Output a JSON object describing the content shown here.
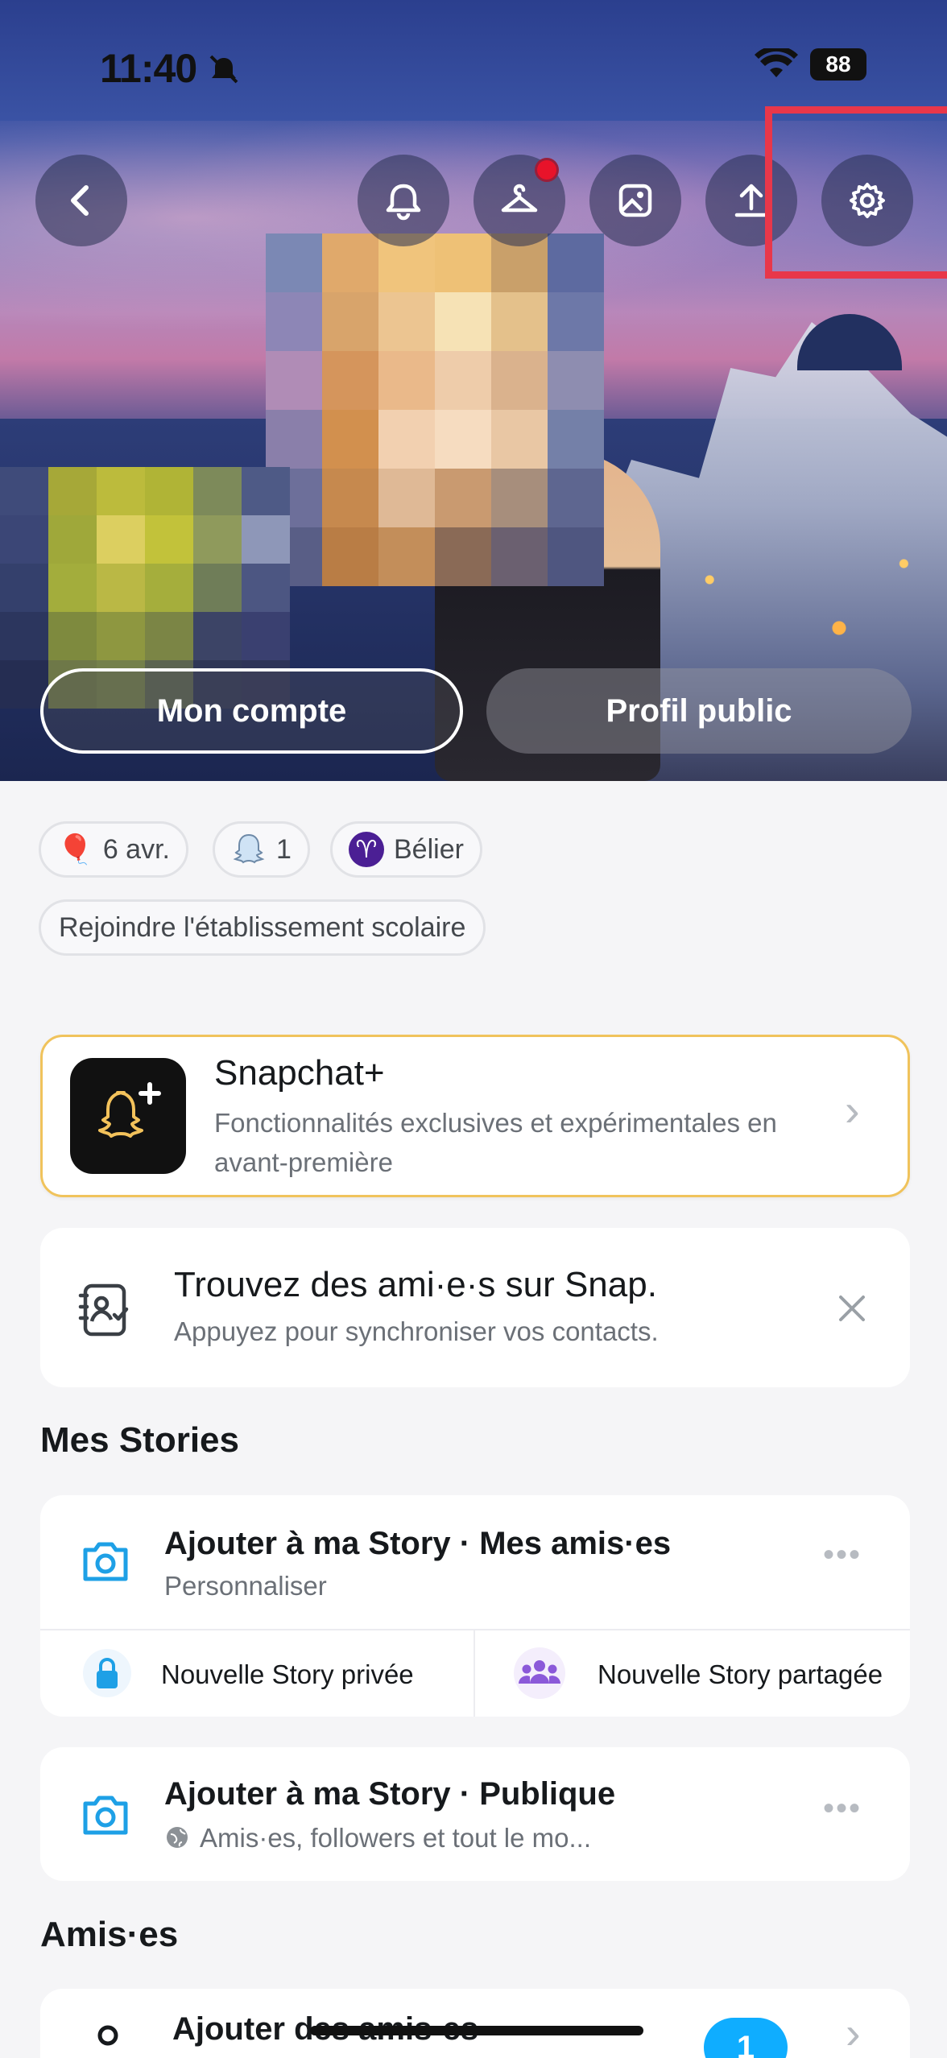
{
  "status_bar": {
    "time": "11:40",
    "battery": "88"
  },
  "profile_header": {
    "buttons": [
      "back",
      "notifications",
      "outfits",
      "backgrounds",
      "share",
      "settings"
    ],
    "tabs": {
      "my_account": "Mon compte",
      "public_profile": "Profil public"
    }
  },
  "chips": {
    "birthday": "6 avr.",
    "friends_count": "1",
    "zodiac": "Bélier",
    "zodiac_symbol": "♈",
    "school": "Rejoindre l'établissement scolaire"
  },
  "snapchat_plus": {
    "title": "Snapchat+",
    "subtitle": "Fonctionnalités exclusives et expérimentales en avant-première"
  },
  "find_friends": {
    "title": "Trouvez des ami·e·s sur Snap.",
    "subtitle": "Appuyez pour synchroniser vos contacts."
  },
  "stories_section": {
    "title": "Mes Stories",
    "my_story": {
      "title": "Ajouter à ma Story · Mes amis·es",
      "subtitle": "Personnaliser"
    },
    "private_story": "Nouvelle Story privée",
    "shared_story": "Nouvelle Story partagée",
    "public_story": {
      "title": "Ajouter à ma Story · Publique",
      "subtitle": "Amis·es, followers et tout le mo..."
    }
  },
  "friends_section": {
    "title": "Amis·es",
    "add_friends": {
      "title": "Ajouter des amis·es",
      "badge": "1"
    }
  },
  "colors": {
    "accent_blue": "#0fadff",
    "highlight_red": "#e8374a",
    "snapchat_plus_border": "#f0c35c",
    "notification_red": "#e8132a"
  }
}
